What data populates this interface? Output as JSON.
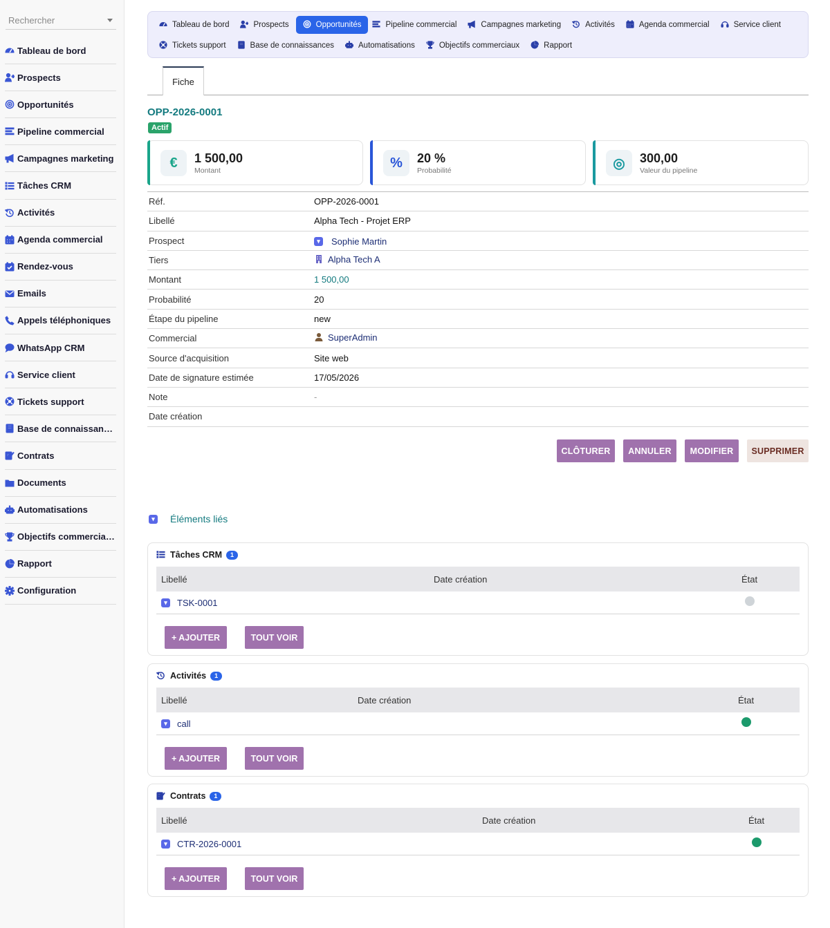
{
  "sidebar": {
    "search_placeholder": "Rechercher",
    "items": [
      {
        "label": "Tableau de bord",
        "icon": "dashboard-icon"
      },
      {
        "label": "Prospects",
        "icon": "user-plus-icon"
      },
      {
        "label": "Opportunités",
        "icon": "target-icon"
      },
      {
        "label": "Pipeline commercial",
        "icon": "bars-icon"
      },
      {
        "label": "Campagnes marketing",
        "icon": "megaphone-icon"
      },
      {
        "label": "Tâches CRM",
        "icon": "tasks-icon"
      },
      {
        "label": "Activités",
        "icon": "history-icon"
      },
      {
        "label": "Agenda commercial",
        "icon": "calendar-icon"
      },
      {
        "label": "Rendez-vous",
        "icon": "calendar-check-icon"
      },
      {
        "label": "Emails",
        "icon": "envelope-icon"
      },
      {
        "label": "Appels téléphoniques",
        "icon": "phone-icon"
      },
      {
        "label": "WhatsApp CRM",
        "icon": "chat-icon"
      },
      {
        "label": "Service client",
        "icon": "headset-icon"
      },
      {
        "label": "Tickets support",
        "icon": "lifebuoy-icon"
      },
      {
        "label": "Base de connaissances",
        "icon": "book-icon"
      },
      {
        "label": "Contrats",
        "icon": "contract-icon"
      },
      {
        "label": "Documents",
        "icon": "folder-icon"
      },
      {
        "label": "Automatisations",
        "icon": "robot-icon"
      },
      {
        "label": "Objectifs commerciaux",
        "icon": "trophy-icon"
      },
      {
        "label": "Rapport",
        "icon": "pie-chart-icon"
      },
      {
        "label": "Configuration",
        "icon": "gear-icon"
      }
    ]
  },
  "topnav": {
    "row1": [
      {
        "label": "Tableau de bord",
        "icon": "dashboard-icon"
      },
      {
        "label": "Prospects",
        "icon": "user-plus-icon"
      },
      {
        "label": "Opportunités",
        "icon": "target-icon",
        "active": true
      },
      {
        "label": "Pipeline commercial",
        "icon": "bars-icon"
      },
      {
        "label": "Campagnes marketing",
        "icon": "megaphone-icon"
      },
      {
        "label": "Activités",
        "icon": "history-icon"
      },
      {
        "label": "Agenda commercial",
        "icon": "calendar-icon"
      },
      {
        "label": "Service client",
        "icon": "headset-icon"
      }
    ],
    "row2": [
      {
        "label": "Tickets support",
        "icon": "lifebuoy-icon"
      },
      {
        "label": "Base de connaissances",
        "icon": "book-icon"
      },
      {
        "label": "Automatisations",
        "icon": "robot-icon"
      },
      {
        "label": "Objectifs commerciaux",
        "icon": "trophy-icon"
      },
      {
        "label": "Rapport",
        "icon": "pie-chart-icon"
      }
    ]
  },
  "tab": {
    "label": "Fiche"
  },
  "record": {
    "ref": "OPP-2026-0001",
    "status": "Actif"
  },
  "kpis": [
    {
      "value": "1 500,00",
      "label": "Montant",
      "symbol": "€",
      "color": "#1aa58a"
    },
    {
      "value": "20 %",
      "label": "Probabilité",
      "symbol": "%",
      "color": "#2a56d8"
    },
    {
      "value": "300,00",
      "label": "Valeur du pipeline",
      "symbol": "◎",
      "color": "#1a9aa0"
    }
  ],
  "fields": {
    "ref": {
      "label": "Réf.",
      "value": "OPP-2026-0001"
    },
    "libelle": {
      "label": "Libellé",
      "value": "Alpha Tech - Projet ERP"
    },
    "prospect": {
      "label": "Prospect",
      "value": "Sophie Martin"
    },
    "tiers": {
      "label": "Tiers",
      "value": "Alpha Tech A"
    },
    "montant": {
      "label": "Montant",
      "value": "1 500,00"
    },
    "probabilite": {
      "label": "Probabilité",
      "value": "20"
    },
    "etape": {
      "label": "Étape du pipeline",
      "value": "new"
    },
    "commercial": {
      "label": "Commercial",
      "value": "SuperAdmin"
    },
    "source": {
      "label": "Source d'acquisition",
      "value": "Site web"
    },
    "date_signature": {
      "label": "Date de signature estimée",
      "value": "17/05/2026"
    },
    "note": {
      "label": "Note",
      "value": "-"
    },
    "date_creation": {
      "label": "Date création",
      "value": ""
    }
  },
  "actions": {
    "close": "CLÔTURER",
    "cancel": "ANNULER",
    "edit": "MODIFIER",
    "delete": "SUPPRIMER"
  },
  "linked": {
    "title": "Éléments liés",
    "add_label": "+ AJOUTER",
    "view_all_label": "TOUT VOIR",
    "col_label": "Libellé",
    "col_date": "Date création",
    "col_state": "État",
    "blocks": [
      {
        "title": "Tâches CRM",
        "count": "1",
        "row": {
          "label": "TSK-0001",
          "date": "",
          "state_color": "#cfd4d8"
        }
      },
      {
        "title": "Activités",
        "count": "1",
        "row": {
          "label": "call",
          "date": "",
          "state_color": "#1c9a6c"
        }
      },
      {
        "title": "Contrats",
        "count": "1",
        "row": {
          "label": "CTR-2026-0001",
          "date": "",
          "state_color": "#1c9a6c"
        }
      }
    ]
  },
  "colors": {
    "accent": "#2a64e8",
    "teal": "#137a7f",
    "button": "#a072ad",
    "status_green": "#2aa36a"
  }
}
